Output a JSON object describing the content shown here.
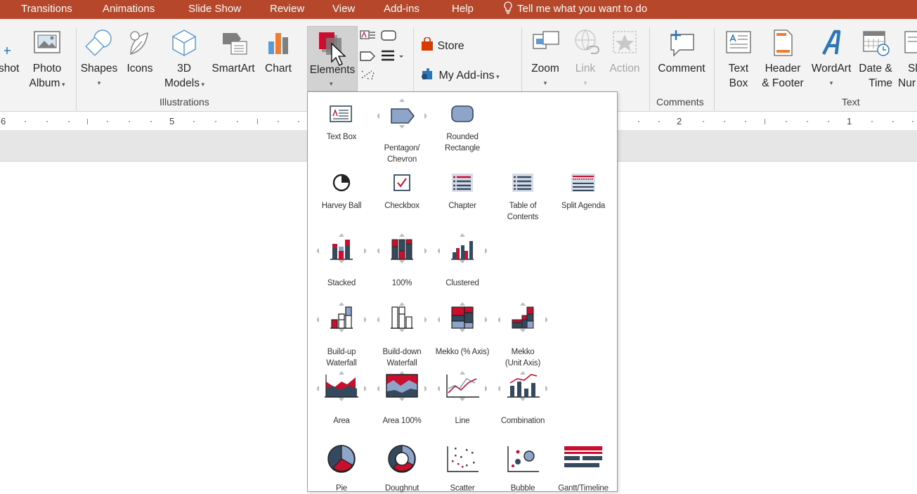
{
  "tabs": [
    "Transitions",
    "Animations",
    "Slide Show",
    "Review",
    "View",
    "Add-ins",
    "Help"
  ],
  "tell_me": "Tell me what you want to do",
  "ribbon": {
    "screenshot_partial": "shot",
    "photo_album": [
      "Photo",
      "Album"
    ],
    "shapes": "Shapes",
    "icons": "Icons",
    "models3d": [
      "3D",
      "Models"
    ],
    "smartart": "SmartArt",
    "chart": "Chart",
    "elements": "Elements",
    "store": "Store",
    "my_addins": "My Add-ins",
    "zoom": "Zoom",
    "link": "Link",
    "action": "Action",
    "comment": "Comment",
    "textbox": [
      "Text",
      "Box"
    ],
    "header_footer": [
      "Header",
      "& Footer"
    ],
    "wordart": "WordArt",
    "datetime": [
      "Date &",
      "Time"
    ],
    "slide_number_partial": [
      "Sli",
      "Nur"
    ],
    "groups": {
      "illustrations": "Illustrations",
      "comments": "Comments",
      "text": "Text"
    }
  },
  "ruler": {
    "left": [
      "6",
      "5"
    ],
    "right": [
      "2",
      "1"
    ]
  },
  "gallery": [
    [
      {
        "name": "text-box",
        "label": [
          "Text Box"
        ]
      },
      {
        "name": "pentagon-chevron",
        "label": [
          "Pentagon/",
          "Chevron"
        ]
      },
      {
        "name": "rounded-rectangle",
        "label": [
          "Rounded",
          "Rectangle"
        ]
      }
    ],
    [
      {
        "name": "harvey-ball",
        "label": [
          "Harvey Ball"
        ]
      },
      {
        "name": "checkbox",
        "label": [
          "Checkbox"
        ]
      },
      {
        "name": "chapter",
        "label": [
          "Chapter"
        ]
      },
      {
        "name": "table-of-contents",
        "label": [
          "Table of",
          "Contents"
        ]
      },
      {
        "name": "split-agenda",
        "label": [
          "Split Agenda"
        ]
      }
    ],
    [
      {
        "name": "stacked",
        "label": [
          "Stacked"
        ]
      },
      {
        "name": "100-percent",
        "label": [
          "100%"
        ]
      },
      {
        "name": "clustered",
        "label": [
          "Clustered"
        ]
      }
    ],
    [
      {
        "name": "build-up-waterfall",
        "label": [
          "Build-up",
          "Waterfall"
        ]
      },
      {
        "name": "build-down-waterfall",
        "label": [
          "Build-down",
          "Waterfall"
        ]
      },
      {
        "name": "mekko-percent-axis",
        "label": [
          "Mekko (% Axis)"
        ]
      },
      {
        "name": "mekko-unit-axis",
        "label": [
          "Mekko",
          "(Unit Axis)"
        ]
      }
    ],
    [
      {
        "name": "area",
        "label": [
          "Area"
        ]
      },
      {
        "name": "area-100",
        "label": [
          "Area 100%"
        ]
      },
      {
        "name": "line",
        "label": [
          "Line"
        ]
      },
      {
        "name": "combination",
        "label": [
          "Combination"
        ]
      }
    ],
    [
      {
        "name": "pie",
        "label": [
          "Pie"
        ]
      },
      {
        "name": "doughnut",
        "label": [
          "Doughnut"
        ]
      },
      {
        "name": "scatter",
        "label": [
          "Scatter"
        ]
      },
      {
        "name": "bubble",
        "label": [
          "Bubble"
        ]
      },
      {
        "name": "gantt-timeline",
        "label": [
          "Gantt/Timeline"
        ]
      }
    ]
  ],
  "colors": {
    "accent": "#b7472a",
    "red": "#c8102e",
    "navy": "#34495e",
    "blue": "#2e75b6"
  }
}
